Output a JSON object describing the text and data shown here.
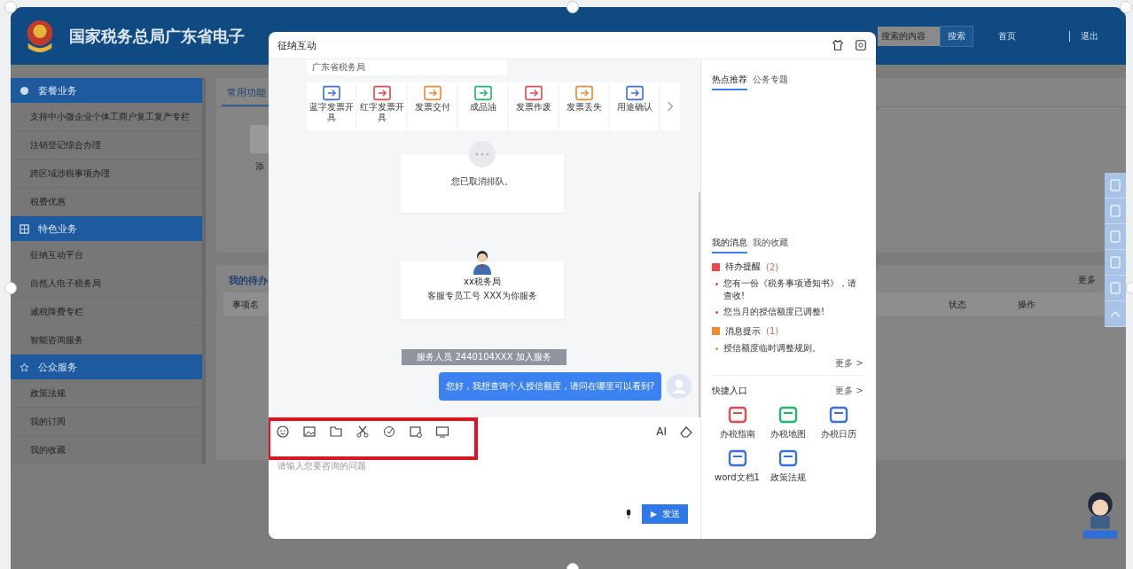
{
  "header": {
    "title": "国家税务总局广东省电子",
    "search": {
      "placeholder": "搜索的内容"
    },
    "search_button": "搜索",
    "links": [
      "首页",
      "退出"
    ]
  },
  "sidebar": {
    "sections": [
      {
        "title": "套餐业务",
        "items": [
          "支持中小微企业个体工商户复工复产专栏",
          "注销登记综合办理",
          "跨区域涉税事项办理",
          "税费优惠"
        ]
      },
      {
        "title": "特色业务",
        "items": [
          "征纳互动平台",
          "自然人电子税务局",
          "减税降费专栏",
          "智能咨询服务"
        ]
      },
      {
        "title": "公众服务",
        "items": [
          "政策法规",
          "我的订阅",
          "我的收藏"
        ]
      }
    ]
  },
  "main": {
    "tabs": [
      {
        "label": "常用功能",
        "selected": true
      }
    ],
    "add_label": "添",
    "todo": {
      "title": "我的待办",
      "more": "更多",
      "columns": [
        "事项名",
        "状态",
        "操作"
      ]
    }
  },
  "dialog": {
    "title": "征纳互动",
    "chat": {
      "top_card": "广东省税务局",
      "tiles": [
        {
          "label": "蓝字发票开具",
          "color": "#3b6fe0"
        },
        {
          "label": "红字发票开具",
          "color": "#e8474c"
        },
        {
          "label": "发票交付",
          "color": "#f08a34"
        },
        {
          "label": "成品油",
          "color": "#1fb86a"
        },
        {
          "label": "发票作废",
          "color": "#e8474c"
        },
        {
          "label": "发票丢失",
          "color": "#f08a34"
        },
        {
          "label": "用途确认",
          "color": "#3b6fe0"
        }
      ],
      "queue_notice": "您已取消排队。",
      "agent": {
        "name": "xx税务局",
        "intro": "客服专员工号 XXX为你服务"
      },
      "system_message": "服务人员 2440104XXX 加入服务",
      "user_message": "您好，我想查询个人授信额度，请问在哪里可以看到?"
    },
    "input": {
      "ai_label": "AI",
      "placeholder": "请输入您要咨询的问题",
      "send": "发送"
    },
    "side": {
      "hot_tabs": [
        {
          "label": "热点推荐",
          "selected": true
        },
        {
          "label": "公务专题",
          "selected": false
        }
      ],
      "msg_tabs": [
        {
          "label": "我的消息",
          "selected": true
        },
        {
          "label": "我的收藏",
          "selected": false
        }
      ],
      "groups": [
        {
          "title": "待办提醒",
          "count": "(2)",
          "color": "#e8474c",
          "items": [
            "您有一份《税务事项通知书》，请查收!",
            "您当月的授信额度已调整!"
          ]
        },
        {
          "title": "消息提示",
          "count": "(1)",
          "color": "#f08a34",
          "items": [
            "授信额度临时调整规则。"
          ]
        }
      ],
      "more": "更多 >",
      "quick": {
        "title": "快捷入口",
        "more": "更多 >",
        "items": [
          {
            "label": "办税指南",
            "color": "#e8474c"
          },
          {
            "label": "办税地图",
            "color": "#1fb86a"
          },
          {
            "label": "办税日历",
            "color": "#3b6fe0"
          },
          {
            "label": "word文档1",
            "color": "#3b6fe0"
          },
          {
            "label": "政策法规",
            "color": "#3b6fe0"
          }
        ]
      }
    }
  }
}
